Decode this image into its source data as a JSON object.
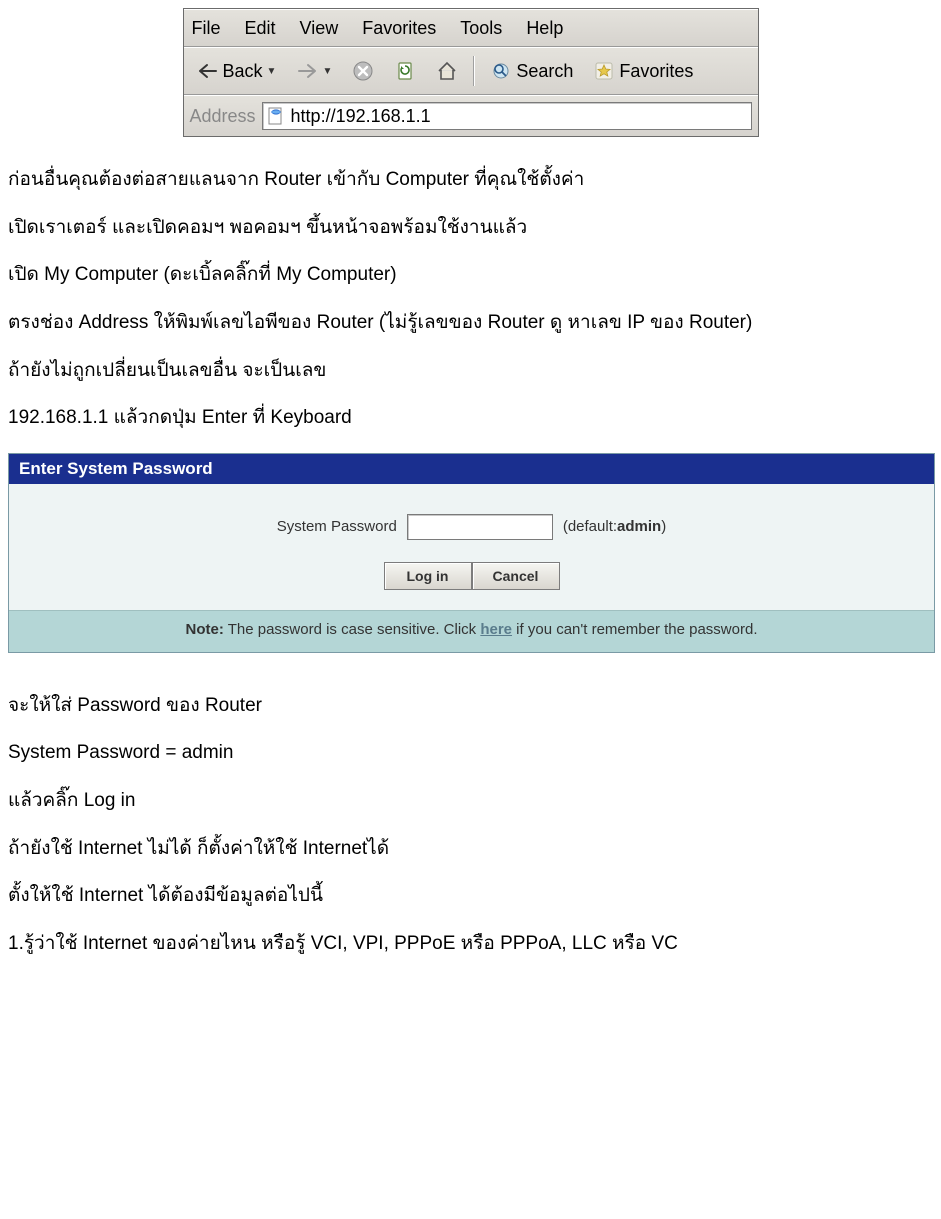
{
  "ie": {
    "menu": {
      "file": "File",
      "edit": "Edit",
      "view": "View",
      "favorites": "Favorites",
      "tools": "Tools",
      "help": "Help"
    },
    "toolbar": {
      "back": "Back",
      "search": "Search",
      "favorites": "Favorites"
    },
    "address_label": "Address",
    "url": "http://192.168.1.1"
  },
  "text": {
    "p1": "ก่อนอื่นคุณต้องต่อสายแลนจาก Router เข้ากับ Computer ที่คุณใช้ตั้งค่า",
    "p2": "เปิดเราเตอร์ และเปิดคอมฯ พอคอมฯ ขึ้นหน้าจอพร้อมใช้งานแล้ว",
    "p3": "เปิด My Computer (ดะเบิ้ลคลิ๊กที่ My Computer)",
    "p4": "ตรงช่อง Address ให้พิมพ์เลขไอพีของ Router (ไม่รู้เลขของ Router ดู หาเลข IP ของ Router)",
    "p5": "ถ้ายังไม่ถูกเปลี่ยนเป็นเลขอื่น จะเป็นเลข",
    "p6": "192.168.1.1 แล้วกดปุ่ม Enter ที่ Keyboard",
    "p7": "จะให้ใส่ Password ของ Router",
    "p8": "System Password = admin",
    "p9": "แล้วคลิ๊ก Log in",
    "p10": "ถ้ายังใช้ Internet ไม่ได้ ก็ตั้งค่าให้ใช้ Internetได้",
    "p11": "ตั้งให้ใช้ Internet ได้ต้องมีข้อมูลต่อไปนี้",
    "p12": "1.รู้ว่าใช้ Internet ของค่ายไหน หรือรู้ VCI, VPI, PPPoE หรือ PPPoA, LLC หรือ VC"
  },
  "login": {
    "title": "Enter System Password",
    "label": "System Password",
    "hint_prefix": "(default:",
    "hint_value": "admin",
    "hint_suffix": ")",
    "btn_login": "Log in",
    "btn_cancel": "Cancel",
    "note_prefix": "Note:",
    "note_text1": " The password is case sensitive. Click ",
    "note_link": "here",
    "note_text2": " if you can't remember the password."
  }
}
